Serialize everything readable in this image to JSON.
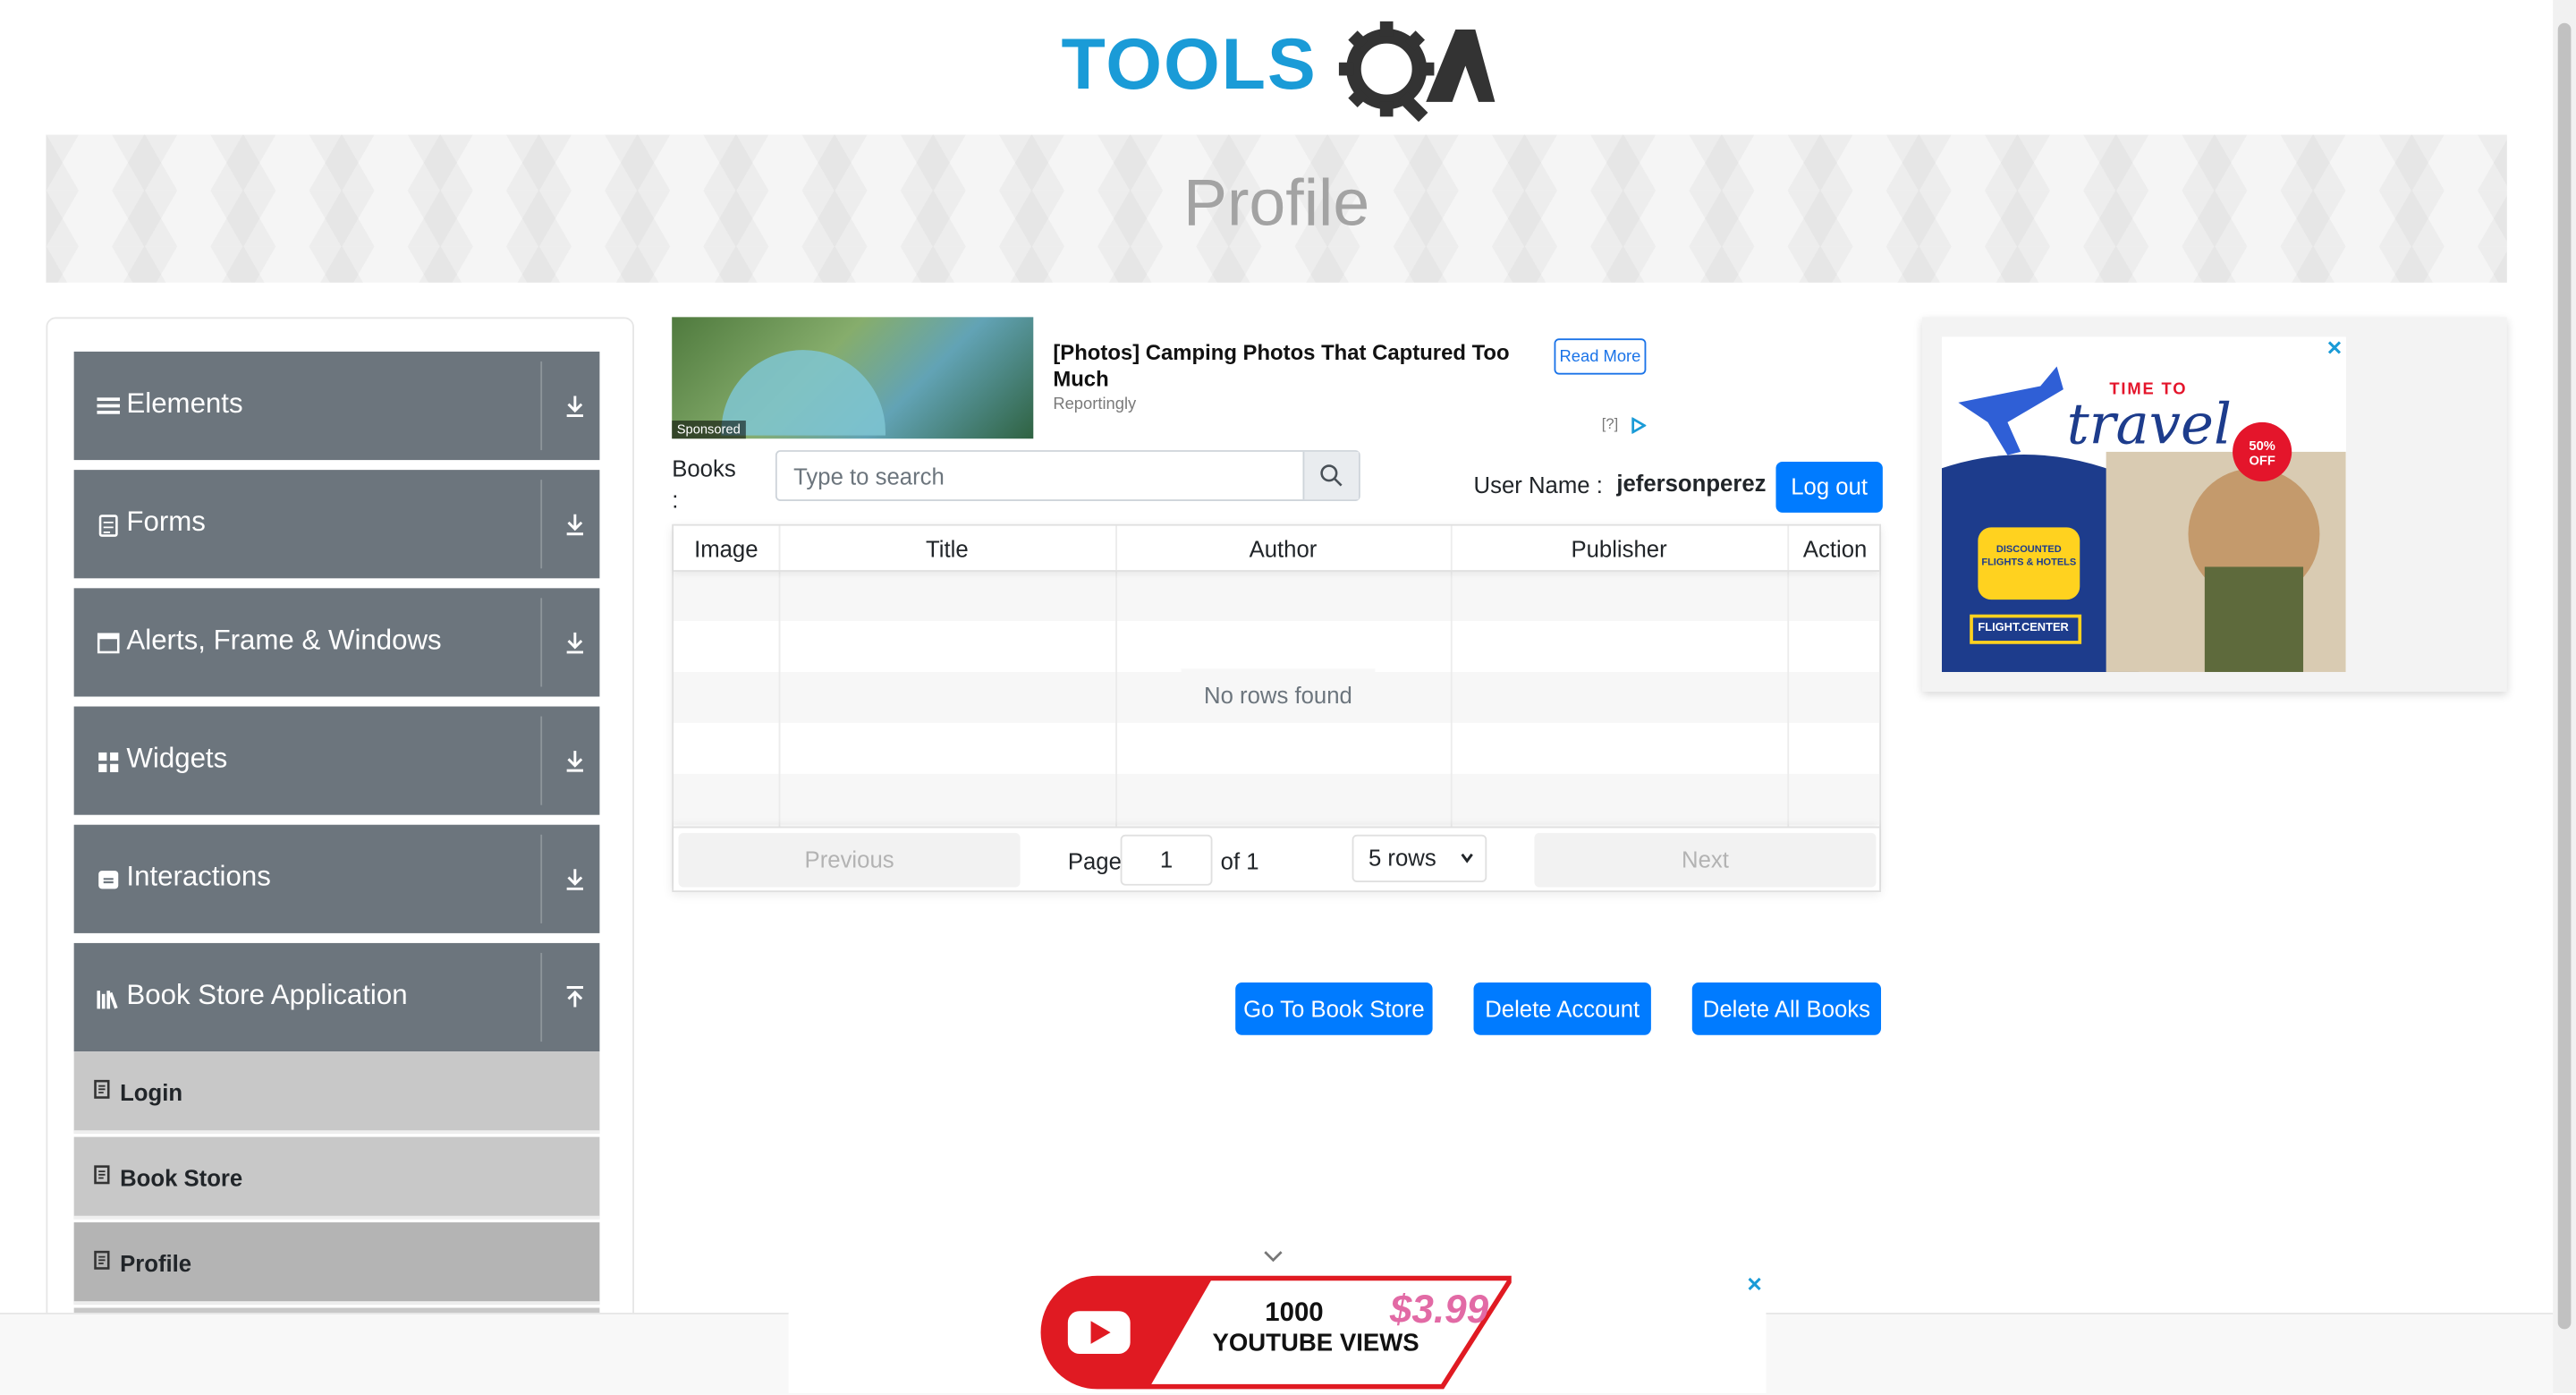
{
  "header": {
    "logo_text": "TOOLSQA",
    "page_title": "Profile"
  },
  "sidebar": {
    "groups": [
      {
        "label": "Elements",
        "icon": "hamburger-icon"
      },
      {
        "label": "Forms",
        "icon": "form-icon"
      },
      {
        "label": "Alerts, Frame & Windows",
        "icon": "window-icon"
      },
      {
        "label": "Widgets",
        "icon": "widgets-icon"
      },
      {
        "label": "Interactions",
        "icon": "interactions-icon"
      },
      {
        "label": "Book Store Application",
        "icon": "books-icon"
      }
    ],
    "items": [
      {
        "label": "Login"
      },
      {
        "label": "Book Store"
      },
      {
        "label": "Profile",
        "active": true
      }
    ]
  },
  "ad_top": {
    "headline": "[Photos] Camping Photos That Captured Too Much",
    "source": "Reportingly",
    "button": "Read More",
    "sponsored": "Sponsored",
    "adchoices": "[?]"
  },
  "profile": {
    "books_label": "Books :",
    "search_placeholder": "Type to search",
    "username_label": "User Name :",
    "username_value": "jefersonperez",
    "logout": "Log out"
  },
  "table": {
    "columns": [
      "Image",
      "Title",
      "Author",
      "Publisher",
      "Action"
    ],
    "empty_text": "No rows found",
    "pagination": {
      "previous": "Previous",
      "next": "Next",
      "page_label": "Page",
      "page_value": "1",
      "of_label": "of 1",
      "rows_select": "5 rows"
    }
  },
  "actions": {
    "go_to_store": "Go To Book Store",
    "delete_account": "Delete Account",
    "delete_all_books": "Delete All Books"
  },
  "ad_right": {
    "line1": "TIME TO",
    "line2": "travel",
    "discount": "50% OFF",
    "badge": "DISCOUNTED FLIGHTS & HOTELS",
    "brand": "FLIGHT.CENTER"
  },
  "ad_bottom": {
    "line1": "1000",
    "line2": "YOUTUBE VIEWS",
    "price": "$3.99"
  },
  "colors": {
    "primary": "#007bff",
    "sidebar_group": "#6c757d",
    "sidebar_item": "#c8c8c8",
    "sidebar_item_active": "#b4b4b4",
    "logo_blue": "#1a9bd7",
    "logo_dark": "#333333"
  }
}
